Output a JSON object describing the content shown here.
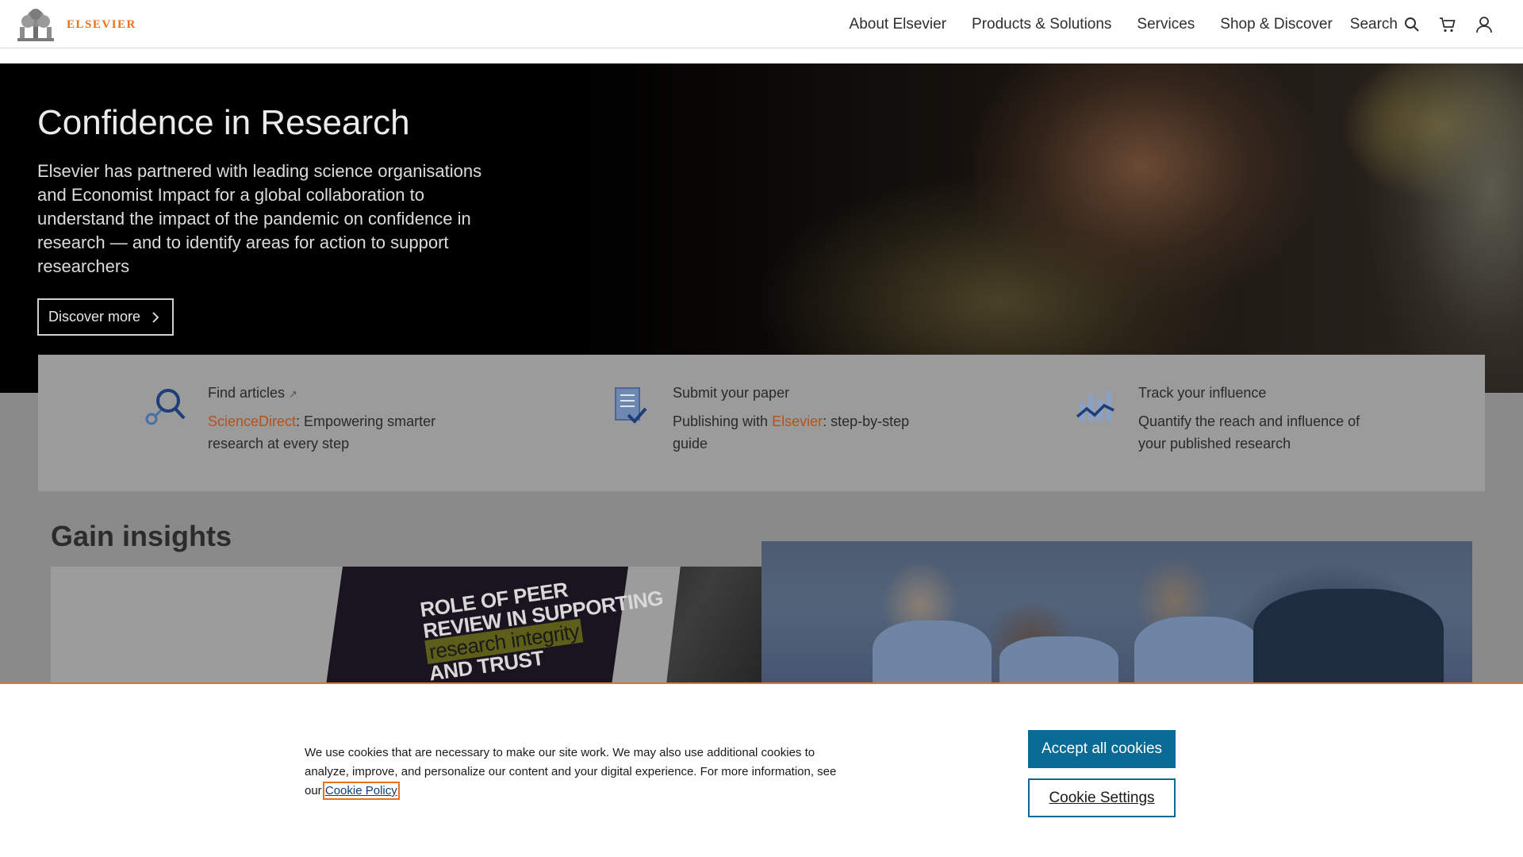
{
  "header": {
    "brand": "ELSEVIER",
    "nav": [
      "About Elsevier",
      "Products & Solutions",
      "Services",
      "Shop & Discover"
    ],
    "search_label": "Search"
  },
  "hero": {
    "title": "Confidence in Research",
    "description": "Elsevier has partnered with leading science organisations and Economist Impact for a global collaboration to understand the impact of the pandemic on confidence in research — and to identify areas for action to support researchers",
    "button_label": "Discover more"
  },
  "cards": [
    {
      "icon": "search-magnifier-icon",
      "title": "Find articles",
      "highlight": "ScienceDirect",
      "text_after": ": Empowering smarter research at every step"
    },
    {
      "icon": "document-check-icon",
      "title": "Submit your paper",
      "text_before": "Publishing with ",
      "highlight": "Elsevier",
      "text_after": ": step-by-step guide"
    },
    {
      "icon": "chart-trend-icon",
      "title": "Track your influence",
      "text_after": "Quantify the reach and influence of your published research"
    }
  ],
  "insights": {
    "title": "Gain insights",
    "poster_lines": [
      "ROLE OF PEER",
      "REVIEW IN SUPPORTING",
      "research integrity",
      "AND TRUST"
    ]
  },
  "cookie": {
    "text": "We use cookies that are necessary to make our site work. We may also use additional cookies to analyze, improve, and personalize our content and your digital experience. For more information, see our ",
    "link_label": "Cookie Policy",
    "accept_label": "Accept all cookies",
    "settings_label": "Cookie Settings"
  },
  "colors": {
    "brand_orange": "#e9711c",
    "accept_blue": "#0a6a96"
  }
}
